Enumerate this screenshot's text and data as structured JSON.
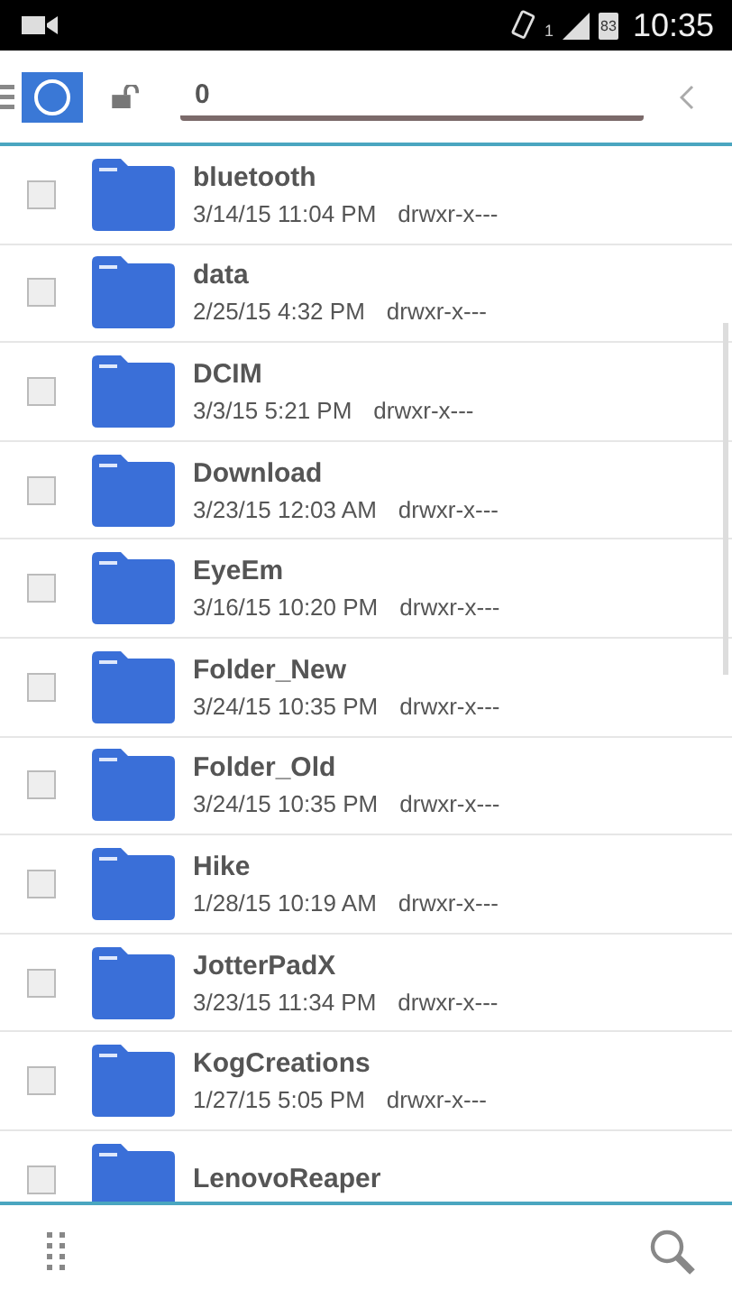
{
  "status_bar": {
    "sim_slot": "1",
    "battery": "83",
    "time": "10:35"
  },
  "toolbar": {
    "path_value": "0"
  },
  "files": [
    {
      "name": "bluetooth",
      "date": "3/14/15 11:04 PM",
      "permissions": "drwxr-x---",
      "checked": false
    },
    {
      "name": "data",
      "date": "2/25/15 4:32 PM",
      "permissions": "drwxr-x---",
      "checked": false
    },
    {
      "name": "DCIM",
      "date": "3/3/15 5:21 PM",
      "permissions": "drwxr-x---",
      "checked": false
    },
    {
      "name": "Download",
      "date": "3/23/15 12:03 AM",
      "permissions": "drwxr-x---",
      "checked": false
    },
    {
      "name": "EyeEm",
      "date": "3/16/15 10:20 PM",
      "permissions": "drwxr-x---",
      "checked": false
    },
    {
      "name": "Folder_New",
      "date": "3/24/15 10:35 PM",
      "permissions": "drwxr-x---",
      "checked": false
    },
    {
      "name": "Folder_Old",
      "date": "3/24/15 10:35 PM",
      "permissions": "drwxr-x---",
      "checked": false
    },
    {
      "name": "Hike",
      "date": "1/28/15 10:19 AM",
      "permissions": "drwxr-x---",
      "checked": false
    },
    {
      "name": "JotterPadX",
      "date": "3/23/15 11:34 PM",
      "permissions": "drwxr-x---",
      "checked": false
    },
    {
      "name": "KogCreations",
      "date": "1/27/15 5:05 PM",
      "permissions": "drwxr-x---",
      "checked": false
    },
    {
      "name": "LenovoReaper",
      "checked": false
    }
  ]
}
